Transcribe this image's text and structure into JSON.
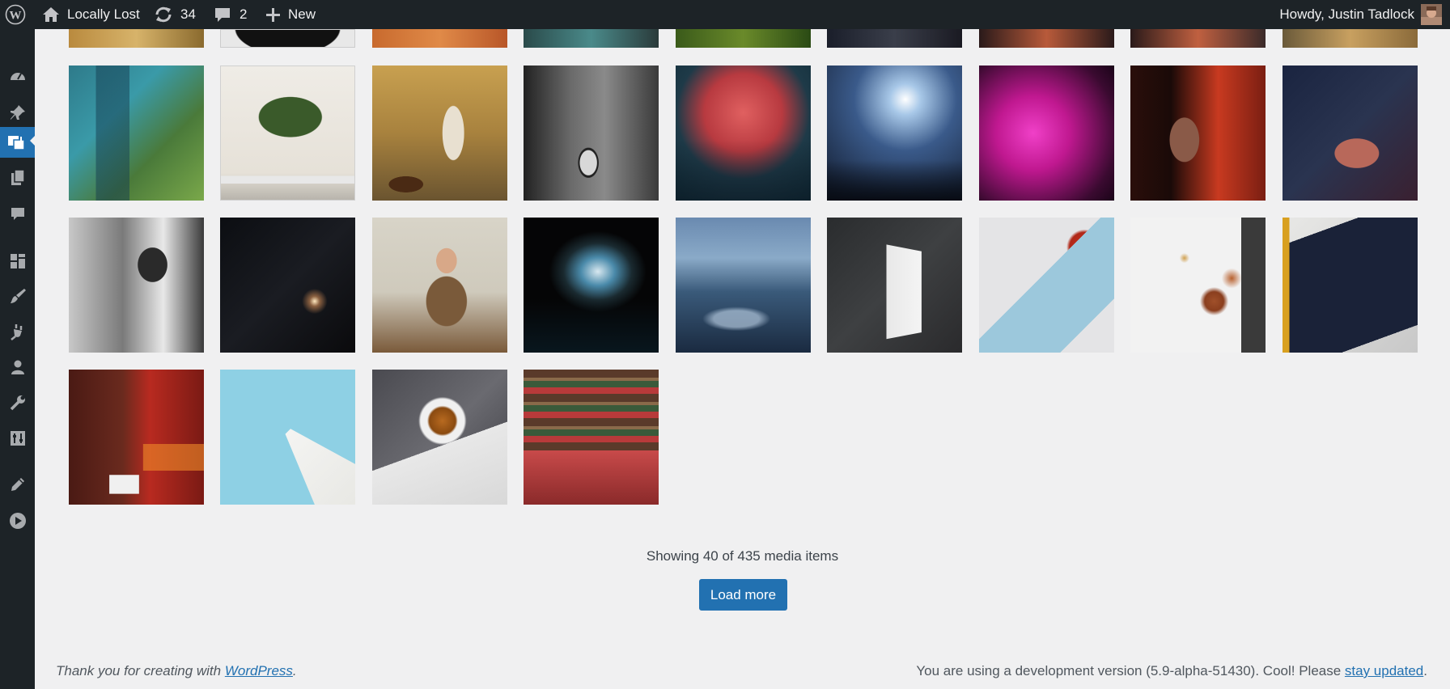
{
  "admin_bar": {
    "site_name": "Locally Lost",
    "updates_count": "34",
    "comments_count": "2",
    "new_label": "New",
    "greeting": "Howdy, Justin Tadlock"
  },
  "sidebar": {
    "items": [
      {
        "icon": "dashboard-icon"
      },
      {
        "icon": "posts-pin-icon"
      },
      {
        "icon": "media-icon",
        "current": true
      },
      {
        "icon": "pages-icon"
      },
      {
        "icon": "comments-icon"
      },
      {
        "icon": "appearance-icon"
      },
      {
        "icon": "appearance-brush-icon"
      },
      {
        "icon": "plugins-icon"
      },
      {
        "icon": "users-icon"
      },
      {
        "icon": "tools-icon"
      },
      {
        "icon": "settings-icon"
      },
      {
        "icon": "edit-pen-icon"
      },
      {
        "icon": "play-icon"
      }
    ]
  },
  "media": {
    "status_text": "Showing 40 of 435 media items",
    "load_more_label": "Load more"
  },
  "colors": {
    "accent": "#2271b1",
    "admin_bar_bg": "#1d2327",
    "page_bg": "#f0f0f1"
  },
  "footer": {
    "thanks_prefix": "Thank you for creating with ",
    "thanks_link": "WordPress",
    "thanks_suffix": ".",
    "version_text": "You are using a development version (5.9-alpha-51430). Cool! Please ",
    "version_link": "stay updated",
    "version_suffix": "."
  }
}
